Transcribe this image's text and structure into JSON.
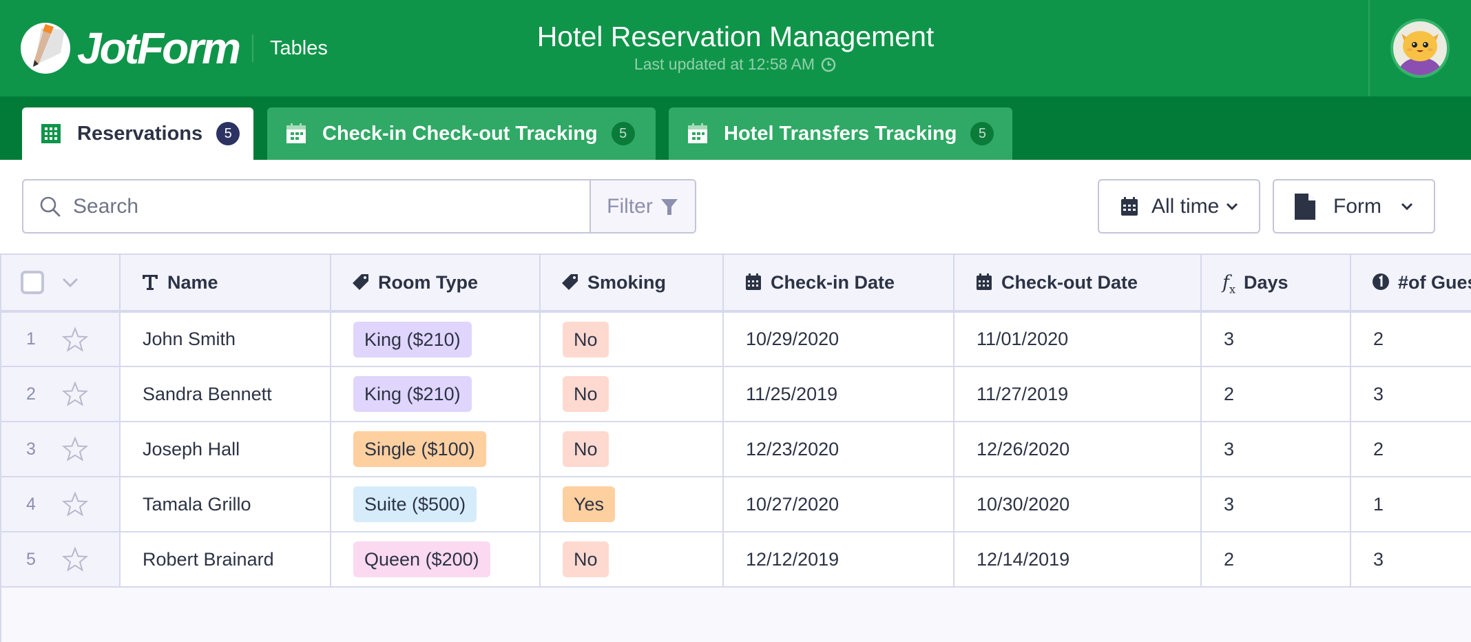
{
  "header": {
    "brand": "JotForm",
    "product": "Tables",
    "title": "Hotel Reservation Management",
    "last_updated": "Last updated at 12:58 AM",
    "avatar_alt": "User avatar"
  },
  "tabs": [
    {
      "label": "Reservations",
      "count": "5",
      "icon": "table-grid-icon",
      "active": true
    },
    {
      "label": "Check-in Check-out Tracking",
      "count": "5",
      "icon": "calendar-icon",
      "active": false
    },
    {
      "label": "Hotel Transfers Tracking",
      "count": "5",
      "icon": "calendar-icon",
      "active": false
    }
  ],
  "toolbar": {
    "search_placeholder": "Search",
    "search_value": "",
    "filter_label": "Filter",
    "date_range_label": "All time",
    "view_label": "Form"
  },
  "table": {
    "columns": [
      {
        "label": "Name",
        "icon": "text-type-icon"
      },
      {
        "label": "Room Type",
        "icon": "tag-icon"
      },
      {
        "label": "Smoking",
        "icon": "tag-icon"
      },
      {
        "label": "Check-in Date",
        "icon": "calendar-icon"
      },
      {
        "label": "Check-out Date",
        "icon": "calendar-icon"
      },
      {
        "label": "Days",
        "icon": "formula-icon"
      },
      {
        "label": "#of Guests",
        "icon": "number-icon"
      }
    ],
    "rows": [
      {
        "num": "1",
        "name": "John Smith",
        "room_type": "King ($210)",
        "room_class": "king",
        "smoking": "No",
        "check_in": "10/29/2020",
        "check_out": "11/01/2020",
        "days": "3",
        "guests": "2"
      },
      {
        "num": "2",
        "name": "Sandra Bennett",
        "room_type": "King ($210)",
        "room_class": "king",
        "smoking": "No",
        "check_in": "11/25/2019",
        "check_out": "11/27/2019",
        "days": "2",
        "guests": "3"
      },
      {
        "num": "3",
        "name": "Joseph Hall",
        "room_type": "Single ($100)",
        "room_class": "single",
        "smoking": "No",
        "check_in": "12/23/2020",
        "check_out": "12/26/2020",
        "days": "3",
        "guests": "2"
      },
      {
        "num": "4",
        "name": "Tamala Grillo",
        "room_type": "Suite ($500)",
        "room_class": "suite",
        "smoking": "Yes",
        "check_in": "10/27/2020",
        "check_out": "10/30/2020",
        "days": "3",
        "guests": "1"
      },
      {
        "num": "5",
        "name": "Robert Brainard",
        "room_type": "Queen ($200)",
        "room_class": "queen",
        "smoking": "No",
        "check_in": "12/12/2019",
        "check_out": "12/14/2019",
        "days": "2",
        "guests": "3"
      }
    ]
  },
  "colors": {
    "header_green": "#0f9549",
    "tabbar_green": "#017b37",
    "inactive_tab": "#2fa965",
    "active_badge": "#2c3262",
    "king_tag": "#e0d5fc",
    "single_tag": "#fecf9f",
    "suite_tag": "#d6ecfa",
    "queen_tag": "#fad9f1",
    "no_tag": "#fed9d0",
    "yes_tag": "#fecf9f"
  }
}
